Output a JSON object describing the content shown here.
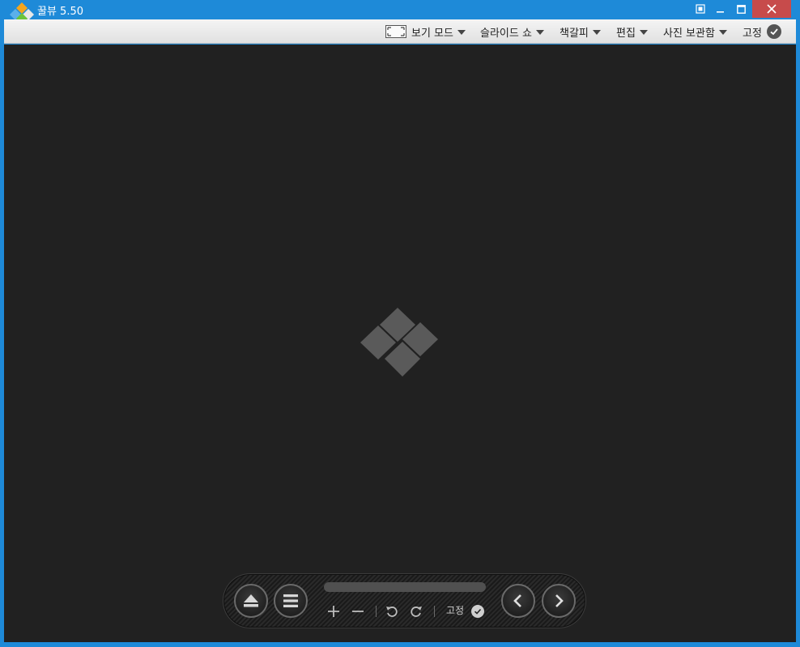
{
  "titlebar": {
    "app_title": "꿀뷰 5.50"
  },
  "menubar": {
    "view_mode_label": "보기 모드",
    "slideshow_label": "슬라이드 쇼",
    "bookmark_label": "책갈피",
    "edit_label": "편집",
    "photo_box_label": "사진 보관함",
    "pin_label": "고정"
  },
  "controlbar": {
    "pin_label": "고정"
  },
  "icons": {
    "app_logo": "app-logo-icon",
    "snap": "fit-window-icon",
    "minimize": "minimize-icon",
    "maximize": "maximize-icon",
    "close": "close-icon",
    "eject": "eject-icon",
    "menu": "hamburger-menu-icon",
    "zoom_in": "plus-icon",
    "zoom_out": "minus-icon",
    "rotate_left": "rotate-left-icon",
    "rotate_right": "rotate-right-icon",
    "previous": "chevron-left-icon",
    "next": "chevron-right-icon"
  },
  "colors": {
    "titlebar": "#1e8ad8",
    "close_button": "#c74b4b",
    "viewer_background": "#212121"
  }
}
